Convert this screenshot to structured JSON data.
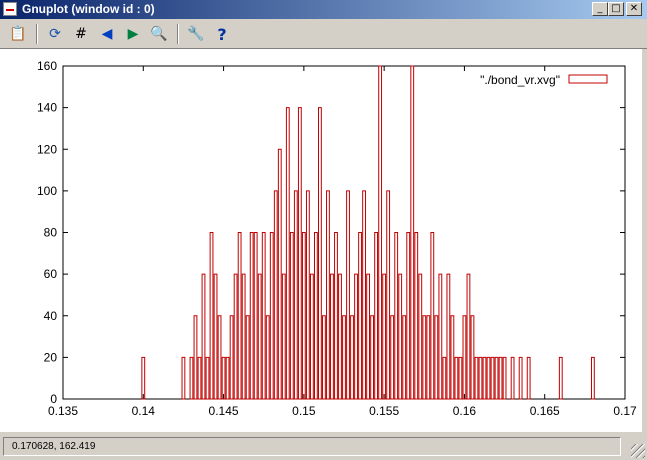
{
  "window": {
    "title": "Gnuplot (window id : 0)",
    "controls": {
      "minimize": "_",
      "maximize": "□",
      "close": "✕"
    }
  },
  "toolbar": {
    "items": [
      {
        "name": "copy-to-clipboard-icon",
        "glyph": "📋",
        "color": "#c08000"
      },
      {
        "name": "replot-icon",
        "glyph": "⟳",
        "color": "#1a50b0"
      },
      {
        "name": "grid-icon",
        "glyph": "#",
        "color": "#000000"
      },
      {
        "name": "previous-zoom-icon",
        "glyph": "◀",
        "color": "#0040c0"
      },
      {
        "name": "next-zoom-icon",
        "glyph": "▶",
        "color": "#008040"
      },
      {
        "name": "unzoom-icon",
        "glyph": "🔍",
        "color": "#0040c0"
      },
      {
        "name": "options-icon",
        "glyph": "🔧",
        "color": "#808080"
      },
      {
        "name": "help-icon",
        "glyph": "?",
        "color": "#0030a0"
      }
    ]
  },
  "status": {
    "coordinates": "0.170628,  162.419"
  },
  "colors": {
    "series": "#c00000",
    "plot_background": "#ffffff"
  },
  "chart_data": {
    "type": "bar",
    "title": "",
    "xlabel": "",
    "ylabel": "",
    "xlim": [
      0.135,
      0.17
    ],
    "ylim": [
      0,
      160
    ],
    "x_ticks": [
      "0.135",
      "0.14",
      "0.145",
      "0.15",
      "0.155",
      "0.16",
      "0.165",
      "0.17"
    ],
    "y_ticks": [
      "0",
      "20",
      "40",
      "60",
      "80",
      "100",
      "120",
      "140",
      "160"
    ],
    "grid": false,
    "legend_position": "top-right",
    "series": [
      {
        "name": "\"./bond_vr.xvg\"",
        "bin_width": 0.00025,
        "x": [
          0.14,
          0.1425,
          0.143,
          0.14325,
          0.1435,
          0.14375,
          0.144,
          0.14425,
          0.1445,
          0.14475,
          0.145,
          0.14525,
          0.1455,
          0.14575,
          0.146,
          0.14625,
          0.1465,
          0.14675,
          0.147,
          0.14725,
          0.1475,
          0.14775,
          0.148,
          0.14825,
          0.1485,
          0.14875,
          0.149,
          0.14925,
          0.1495,
          0.14975,
          0.15,
          0.15025,
          0.1505,
          0.15075,
          0.151,
          0.15125,
          0.1515,
          0.15175,
          0.152,
          0.15225,
          0.1525,
          0.15275,
          0.153,
          0.15325,
          0.1535,
          0.15375,
          0.154,
          0.15425,
          0.1545,
          0.15475,
          0.155,
          0.15525,
          0.1555,
          0.15575,
          0.156,
          0.15625,
          0.1565,
          0.15675,
          0.157,
          0.15725,
          0.1575,
          0.15775,
          0.158,
          0.15825,
          0.1585,
          0.15875,
          0.159,
          0.15925,
          0.1595,
          0.15975,
          0.16,
          0.16025,
          0.1605,
          0.16075,
          0.161,
          0.16125,
          0.1615,
          0.16175,
          0.162,
          0.16225,
          0.1625,
          0.163,
          0.1635,
          0.164,
          0.166,
          0.168
        ],
        "values": [
          20,
          20,
          20,
          40,
          20,
          60,
          20,
          80,
          60,
          40,
          20,
          20,
          40,
          60,
          80,
          60,
          40,
          80,
          80,
          60,
          80,
          40,
          80,
          100,
          120,
          60,
          140,
          80,
          100,
          140,
          80,
          100,
          60,
          80,
          140,
          40,
          100,
          60,
          80,
          60,
          40,
          100,
          40,
          60,
          80,
          100,
          60,
          40,
          80,
          160,
          60,
          100,
          40,
          80,
          60,
          40,
          80,
          160,
          80,
          60,
          40,
          40,
          80,
          40,
          60,
          20,
          60,
          40,
          20,
          20,
          40,
          60,
          40,
          20,
          20,
          20,
          20,
          20,
          20,
          20,
          20,
          20,
          20,
          20,
          20,
          20
        ]
      }
    ]
  }
}
